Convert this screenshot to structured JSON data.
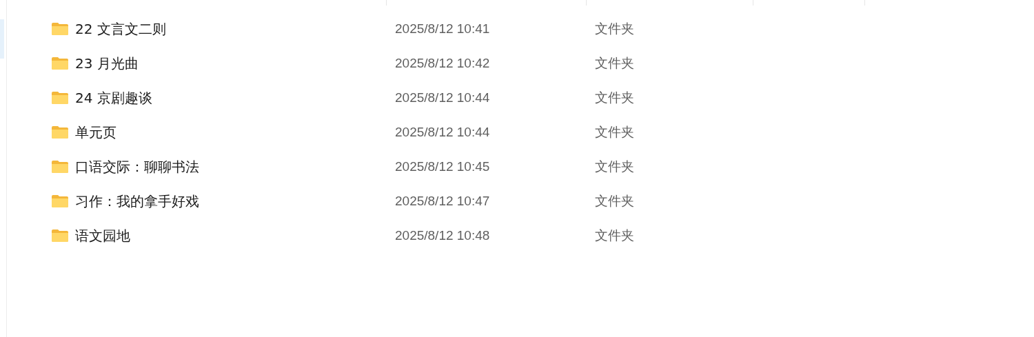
{
  "files": [
    {
      "name": "22 文言文二则",
      "modified": "2025/8/12 10:41",
      "type": "文件夹"
    },
    {
      "name": "23 月光曲",
      "modified": "2025/8/12 10:42",
      "type": "文件夹"
    },
    {
      "name": "24 京剧趣谈",
      "modified": "2025/8/12 10:44",
      "type": "文件夹"
    },
    {
      "name": "单元页",
      "modified": "2025/8/12 10:44",
      "type": "文件夹"
    },
    {
      "name": "口语交际：聊聊书法",
      "modified": "2025/8/12 10:45",
      "type": "文件夹"
    },
    {
      "name": "习作：我的拿手好戏",
      "modified": "2025/8/12 10:47",
      "type": "文件夹"
    },
    {
      "name": "语文园地",
      "modified": "2025/8/12 10:48",
      "type": "文件夹"
    }
  ]
}
